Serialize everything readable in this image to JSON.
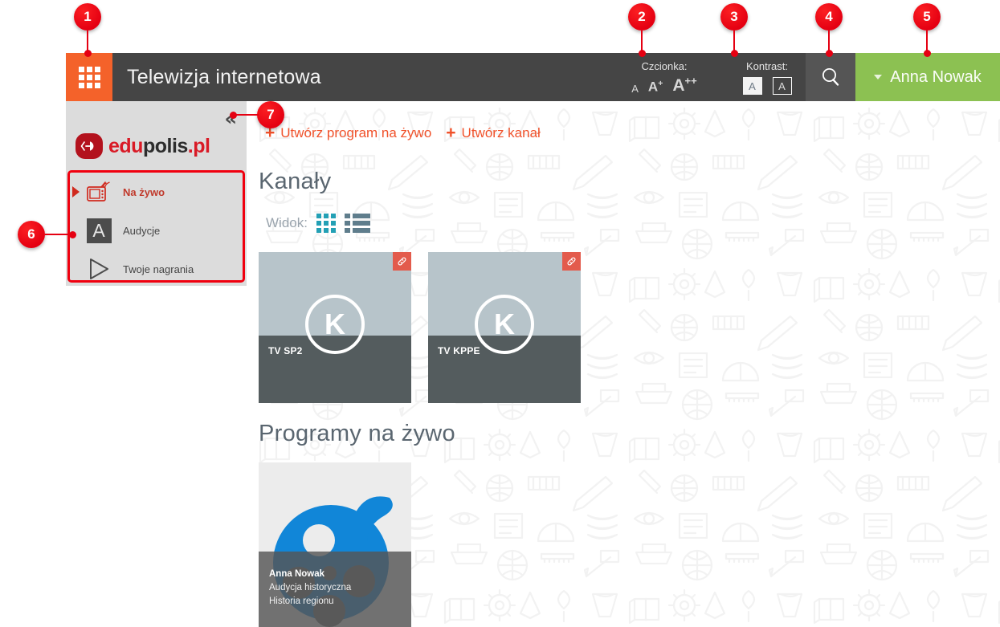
{
  "header": {
    "menu_icon": "grid-apps-icon",
    "title": "Telewizja internetowa",
    "font_size": {
      "label": "Czcionka:",
      "options": [
        {
          "name": "font-size-normal",
          "label": "A",
          "sup": ""
        },
        {
          "name": "font-size-large",
          "label": "A",
          "sup": "+"
        },
        {
          "name": "font-size-xlarge",
          "label": "A",
          "sup": "++"
        }
      ]
    },
    "contrast": {
      "label": "Kontrast:",
      "options": [
        {
          "name": "contrast-light",
          "label": "A"
        },
        {
          "name": "contrast-dark",
          "label": "A"
        }
      ]
    },
    "search_icon": "search-icon",
    "user": {
      "name": "Anna Nowak",
      "caret_icon": "chevron-down-icon"
    }
  },
  "sidebar": {
    "collapse_icon": "double-chevron-left-icon",
    "brand": {
      "mark_icon": "edupolis-logo-icon",
      "part1": "edu",
      "part2": "polis",
      "part3": ".pl"
    },
    "items": [
      {
        "label": "Na żywo",
        "icon": "tv-broadcast-icon",
        "active": true
      },
      {
        "label": "Audycje",
        "icon": "letter-a-icon",
        "active": false
      },
      {
        "label": "Twoje nagrania",
        "icon": "play-triangle-icon",
        "active": false
      }
    ]
  },
  "main": {
    "actions": [
      {
        "label": "Utwórz program na żywo",
        "icon": "plus-icon"
      },
      {
        "label": "Utwórz kanał",
        "icon": "plus-icon"
      }
    ],
    "channels_section": {
      "title": "Kanały",
      "view": {
        "label": "Widok:",
        "grid_icon": "grid-view-icon",
        "list_icon": "list-view-icon",
        "active": "grid"
      },
      "cards": [
        {
          "name": "TV SP2",
          "avatar_letter": "K",
          "badge_icon": "link-icon"
        },
        {
          "name": "TV KPPE",
          "avatar_letter": "K",
          "badge_icon": "link-icon"
        }
      ]
    },
    "programs_section": {
      "title": "Programy na żywo",
      "cards": [
        {
          "author": "Anna Nowak",
          "line1": "Audycja historyczna",
          "line2": "Historia regionu",
          "thumb_icon": "film-reel-icon"
        }
      ]
    }
  },
  "callouts": [
    {
      "number": "1"
    },
    {
      "number": "2"
    },
    {
      "number": "3"
    },
    {
      "number": "4"
    },
    {
      "number": "5"
    },
    {
      "number": "6"
    },
    {
      "number": "7"
    }
  ],
  "colors": {
    "orange": "#f4622a",
    "header_dark": "#454545",
    "green": "#8cc152",
    "accent_red": "#e50012",
    "link_orange": "#f0512a",
    "teal": "#23a0b5"
  }
}
